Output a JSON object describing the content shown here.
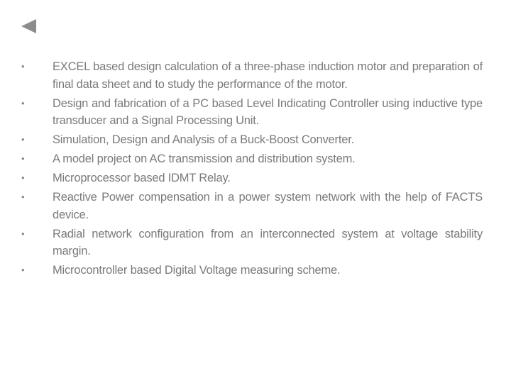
{
  "nav": {
    "back_icon": "triangle-left-icon"
  },
  "projects": [
    "EXCEL based design calculation of a three-phase induction motor and preparation of final data sheet and to study the performance of the motor.",
    "Design and fabrication of a PC based Level Indicating Controller using inductive type transducer and a Signal Processing Unit.",
    "Simulation, Design and Analysis of a Buck-Boost Converter.",
    "A model project on AC transmission and distribution system.",
    "Microprocessor based IDMT Relay.",
    "Reactive Power compensation in a power system network with the help of FACTS device.",
    "Radial network configuration from an interconnected system at voltage stability margin.",
    "Microcontroller based Digital Voltage measuring scheme."
  ],
  "bullet_char": "•"
}
